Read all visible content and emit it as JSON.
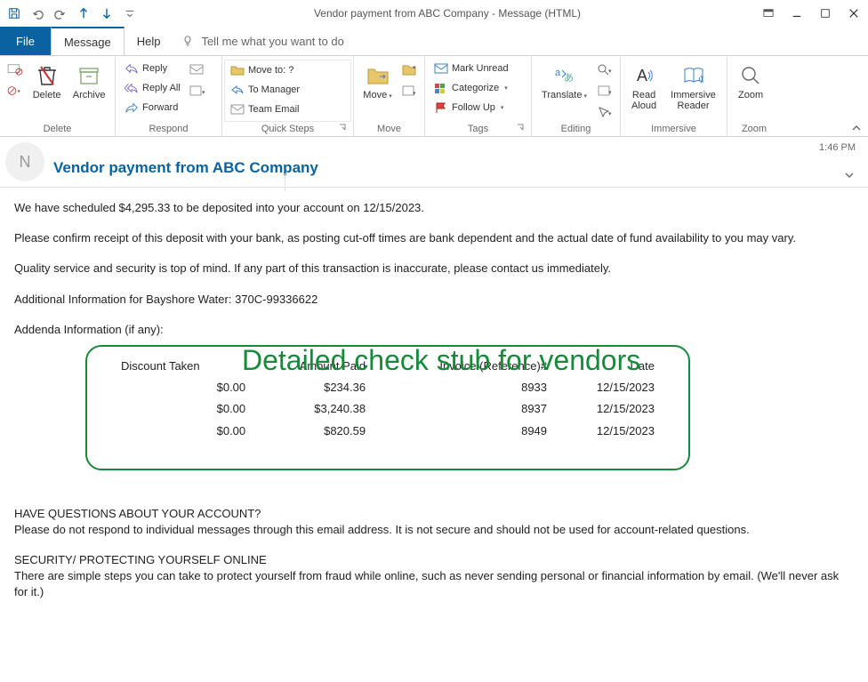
{
  "window": {
    "title": "Vendor payment from ABC Company  -  Message (HTML)"
  },
  "menubar": {
    "file": "File",
    "message": "Message",
    "help": "Help",
    "tell_me": "Tell me what you want to do"
  },
  "ribbon": {
    "delete": {
      "delete": "Delete",
      "archive": "Archive",
      "group": "Delete"
    },
    "respond": {
      "reply": "Reply",
      "reply_all": "Reply All",
      "forward": "Forward",
      "group": "Respond"
    },
    "quicksteps": {
      "move_to": "Move to: ?",
      "to_manager": "To Manager",
      "team_email": "Team Email",
      "group": "Quick Steps"
    },
    "move": {
      "move": "Move",
      "group": "Move"
    },
    "tags": {
      "unread": "Mark Unread",
      "categorize": "Categorize",
      "followup": "Follow Up",
      "group": "Tags"
    },
    "editing": {
      "translate": "Translate",
      "group": "Editing"
    },
    "immersive": {
      "read_aloud": "Read\nAloud",
      "immersive_reader": "Immersive\nReader",
      "group": "Immersive"
    },
    "zoom": {
      "zoom": "Zoom",
      "group": "Zoom"
    }
  },
  "email": {
    "avatar_initial": "N",
    "subject": "Vendor payment from ABC Company",
    "time": "1:46 PM",
    "p1": "We have scheduled $4,295.33 to be deposited into your account on 12/15/2023.",
    "p2": "Please confirm receipt of this deposit with your bank, as posting cut-off times are bank dependent and the actual date of fund availability to you may vary.",
    "p3": "Quality service and security is top of mind. If any part of this transaction is inaccurate, please contact us immediately.",
    "p4": "Additional Information for Bayshore Water: 370C-99336622",
    "p5": "Addenda Information (if any):",
    "callout": "Detailed check stub for vendors",
    "stub_headers": {
      "discount": "Discount Taken",
      "amount": "Amount Paid",
      "invoice": "Invoice (Reference)#",
      "date": "Date"
    },
    "stub_rows": [
      {
        "discount": "$0.00",
        "amount": "$234.36",
        "invoice": "8933",
        "date": "12/15/2023"
      },
      {
        "discount": "$0.00",
        "amount": "$3,240.38",
        "invoice": "8937",
        "date": "12/15/2023"
      },
      {
        "discount": "$0.00",
        "amount": "$820.59",
        "invoice": "8949",
        "date": "12/15/2023"
      }
    ],
    "questions_hdr": "HAVE QUESTIONS ABOUT YOUR ACCOUNT?",
    "questions_body": "Please do not respond to individual messages through this email address. It is not secure and should not be used for account-related questions.",
    "security_hdr": "SECURITY/ PROTECTING YOURSELF ONLINE",
    "security_body": "There are simple steps you can take to protect yourself from fraud while online, such as never sending personal or financial information by email. (We'll never ask for it.)"
  }
}
